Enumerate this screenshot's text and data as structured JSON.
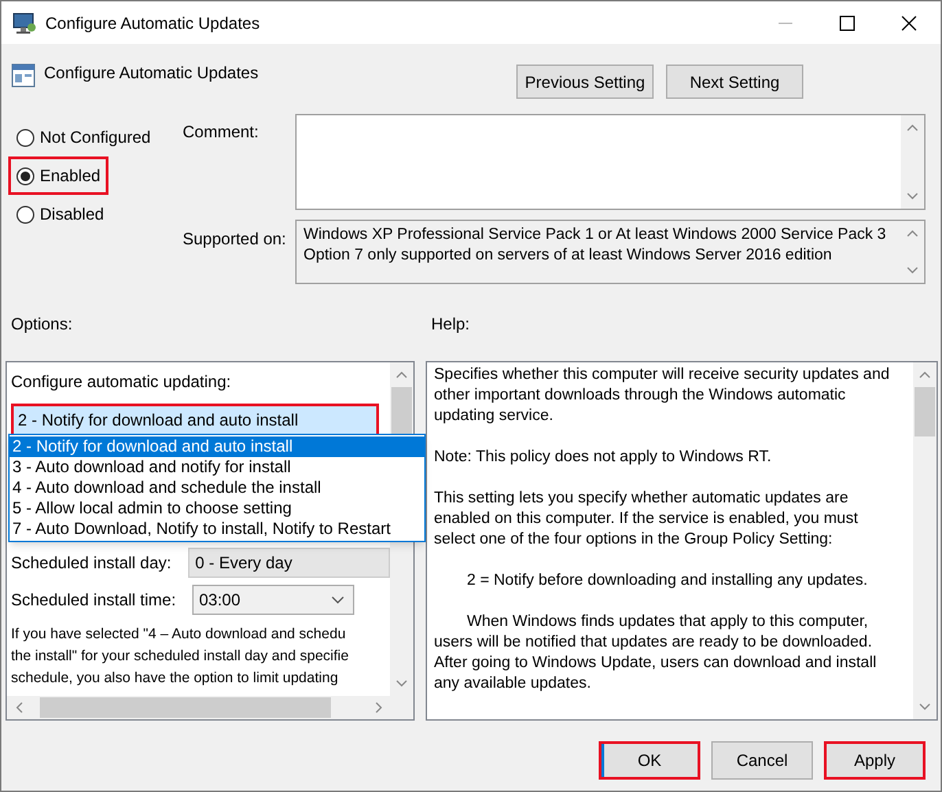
{
  "window": {
    "title": "Configure Automatic Updates"
  },
  "header": {
    "title": "Configure Automatic Updates",
    "buttons": [
      {
        "label": "Previous Setting"
      },
      {
        "label": "Next Setting"
      }
    ]
  },
  "state_options": [
    {
      "label": "Not Configured",
      "selected": false,
      "highlighted": false
    },
    {
      "label": "Enabled",
      "selected": true,
      "highlighted": true
    },
    {
      "label": "Disabled",
      "selected": false,
      "highlighted": false
    }
  ],
  "comment": {
    "label": "Comment:"
  },
  "supported_on": {
    "label": "Supported on:",
    "lines": [
      "Windows XP Professional Service Pack 1 or At least Windows 2000 Service Pack 3",
      "Option 7 only supported on servers of at least Windows Server 2016 edition"
    ]
  },
  "options": {
    "label": "Options:",
    "heading": "Configure automatic updating:",
    "dropdown": {
      "value": "2 - Notify for download and auto install",
      "highlighted": true,
      "expanded": true,
      "items": [
        {
          "label": "2 - Notify for download and auto install",
          "selected": true
        },
        {
          "label": "3 - Auto download and notify for install",
          "selected": false
        },
        {
          "label": "4 - Auto download and schedule the install",
          "selected": false
        },
        {
          "label": "5 - Allow local admin to choose setting",
          "selected": false
        },
        {
          "label": "7 - Auto Download, Notify to install, Notify to Restart",
          "selected": false
        }
      ]
    },
    "fields": [
      {
        "label": "Scheduled install day:",
        "value": "0 - Every day",
        "disabled": true
      },
      {
        "label": "Scheduled install time:",
        "value": "03:00",
        "disabled": false
      }
    ],
    "note_lines": [
      "If you have selected \"4 – Auto download and schedu",
      "the install\" for your scheduled install day and specifie",
      "schedule, you also have the option to limit updating"
    ]
  },
  "help": {
    "label": "Help:",
    "paragraphs": [
      {
        "indent": false,
        "lines": [
          "Specifies whether this computer will receive security updates and",
          "other important downloads through the Windows automatic",
          "updating service."
        ]
      },
      {
        "indent": false,
        "lines": [
          "Note: This policy does not apply to Windows RT."
        ]
      },
      {
        "indent": false,
        "lines": [
          "This setting lets you specify whether automatic updates are",
          "enabled on this computer. If the service is enabled, you must",
          "select one of the four options in the Group Policy Setting:"
        ]
      },
      {
        "indent": true,
        "lines": [
          "2 = Notify before downloading and installing any updates."
        ]
      },
      {
        "indent": true,
        "lines": [
          "When Windows finds updates that apply to this computer,",
          "users will be notified that updates are ready to be downloaded.",
          "After going to Windows Update, users can download and install",
          "any available updates."
        ]
      }
    ]
  },
  "buttons": [
    {
      "label": "OK",
      "highlighted": true,
      "focused": true
    },
    {
      "label": "Cancel",
      "highlighted": false,
      "focused": false
    },
    {
      "label": "Apply",
      "highlighted": true,
      "focused": false
    }
  ]
}
